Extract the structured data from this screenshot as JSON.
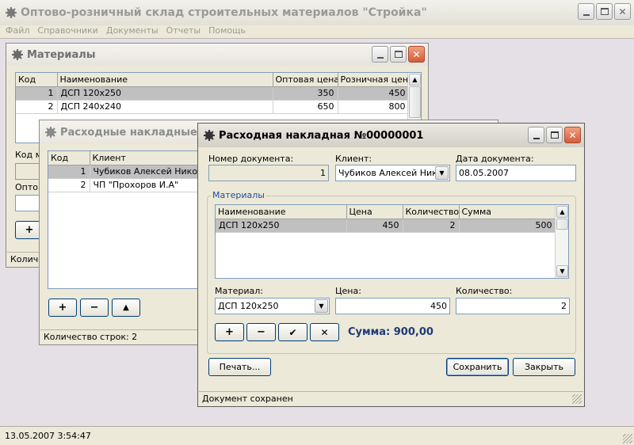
{
  "app": {
    "title": "Оптово-розничный склад строительных материалов \"Стройка\"",
    "menu": [
      "Файл",
      "Справочники",
      "Документы",
      "Отчеты",
      "Помощь"
    ],
    "status_datetime": "13.05.2007 3:54:47"
  },
  "materials_window": {
    "title": "Материалы",
    "columns": [
      "Код",
      "Наименование",
      "Оптовая цена",
      "Розничная цена"
    ],
    "rows": [
      {
        "code": "1",
        "name": "ДСП 120x250",
        "wholesale": "350",
        "retail": "450"
      },
      {
        "code": "2",
        "name": "ДСП 240x240",
        "wholesale": "650",
        "retail": "800"
      }
    ],
    "code_label": "Код м",
    "wholesale_label": "Оптов",
    "add_button": "+",
    "status": "Количе"
  },
  "invoices_window": {
    "title": "Расходные накладные",
    "columns": [
      "Код",
      "Клиент"
    ],
    "rows": [
      {
        "code": "1",
        "client": "Чубиков Алексей Николае"
      },
      {
        "code": "2",
        "client": "ЧП \"Прохоров И.А\""
      }
    ],
    "buttons": {
      "add": "+",
      "remove": "−",
      "up": "▲"
    },
    "status": "Количество строк: 2"
  },
  "invoice_dialog": {
    "title": "Расходная накладная №00000001",
    "doc_number_label": "Номер документа:",
    "doc_number": "1",
    "client_label": "Клиент:",
    "client_value": "Чубиков Алексей Никол",
    "date_label": "Дата документа:",
    "date_value": "08.05.2007",
    "materials_group": "Материалы",
    "columns": [
      "Наименование",
      "Цена",
      "Количество",
      "Сумма"
    ],
    "rows": [
      {
        "name": "ДСП 120x250",
        "price": "450",
        "qty": "2",
        "sum": "500"
      }
    ],
    "material_label": "Материал:",
    "material_value": "ДСП 120x250",
    "price_label": "Цена:",
    "price_value": "450",
    "qty_label": "Количество:",
    "qty_value": "2",
    "buttons": {
      "add": "+",
      "remove": "−",
      "ok": "✔",
      "cancel": "✕"
    },
    "total": "Сумма: 900,00",
    "print_button": "Печать...",
    "save_button": "Сохранить",
    "close_button": "Закрыть",
    "status": "Документ сохранен"
  },
  "colors": {
    "total_text": "#1f3a7a",
    "titlebar_active": "#d8d6cc",
    "titlebar_inactive": "#e8e6e0"
  }
}
